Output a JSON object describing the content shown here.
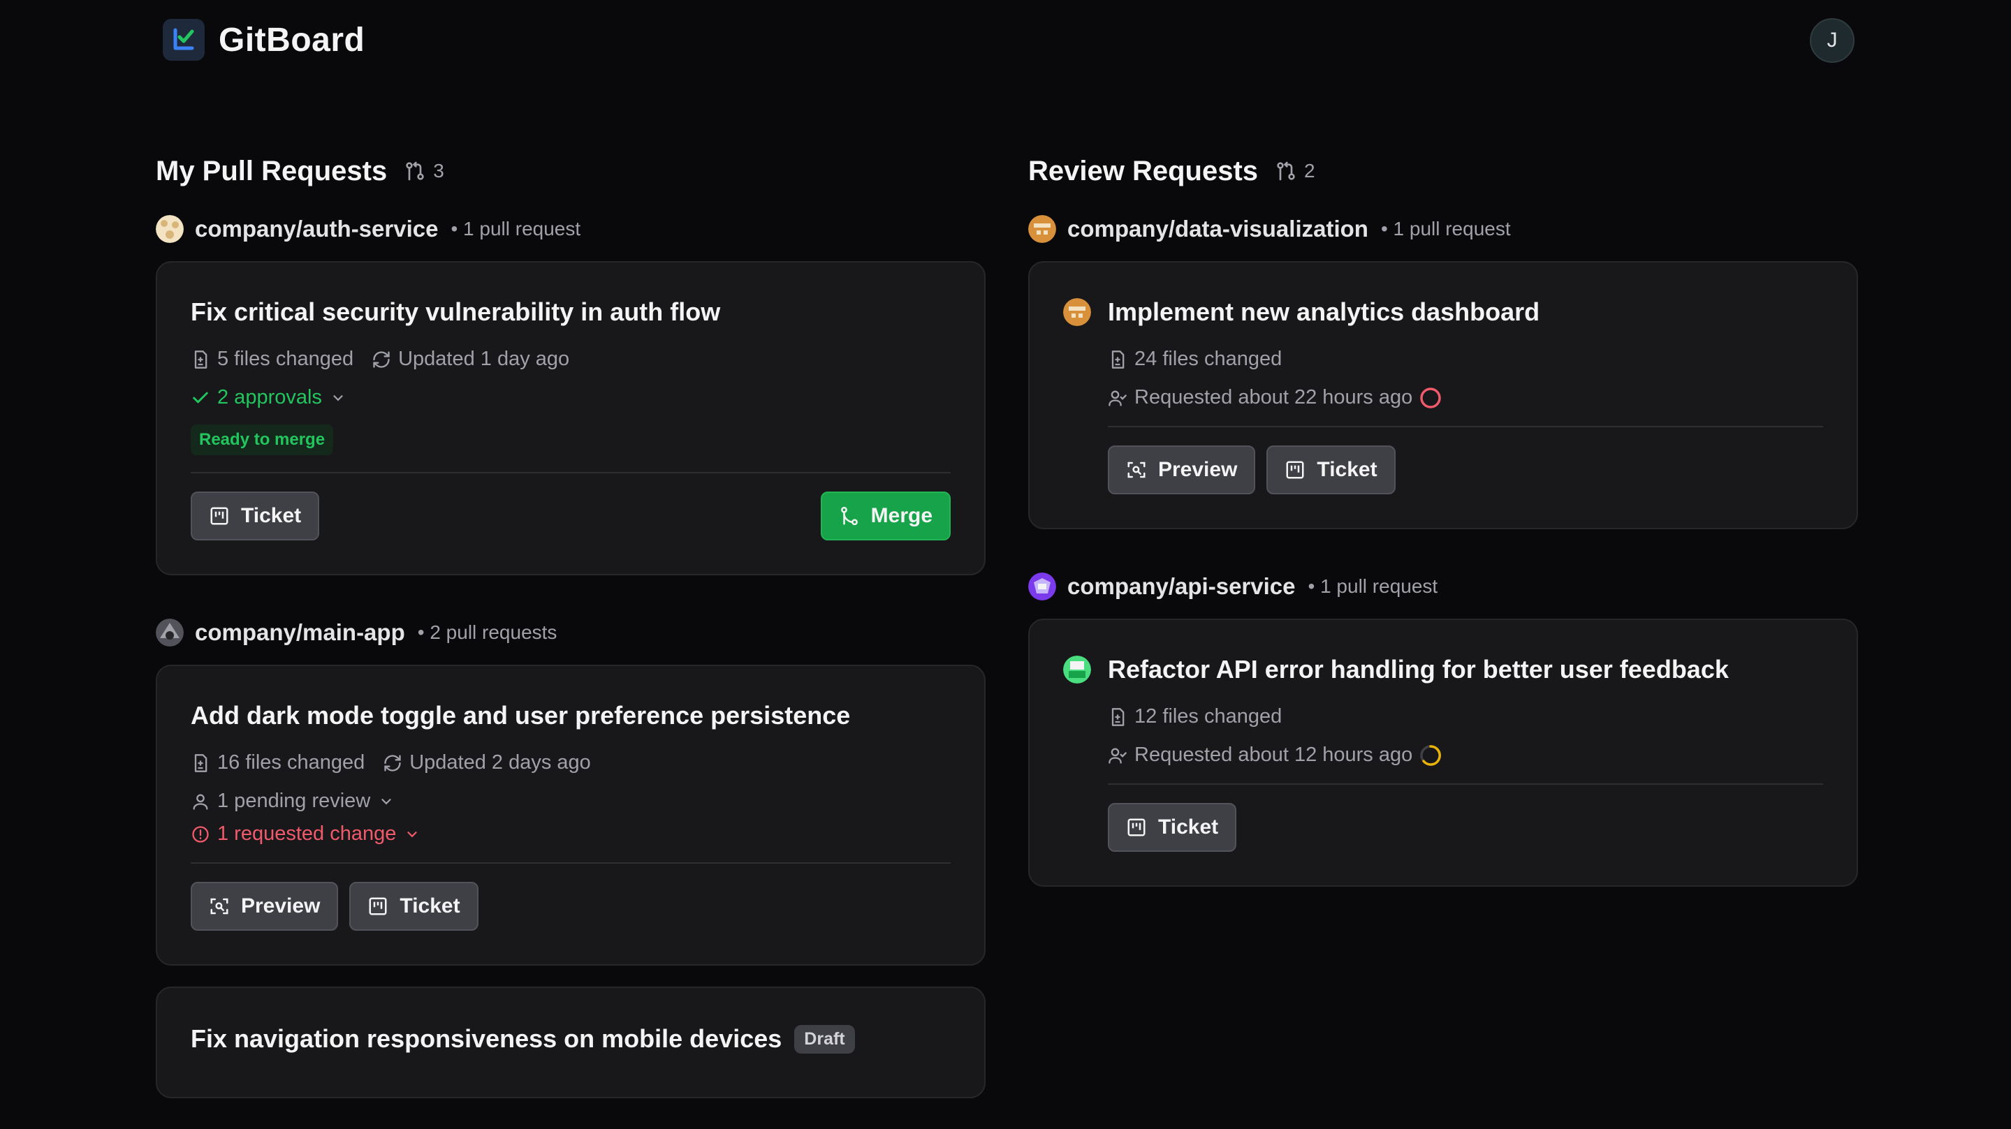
{
  "app": {
    "name": "GitBoard",
    "user_initial": "J"
  },
  "colors": {
    "background": "#09090b",
    "card": "#18181b",
    "success": "#22c55e",
    "danger": "#f05a6a",
    "warning": "#eab308",
    "merge": "#16a34a"
  },
  "my_prs": {
    "title": "My Pull Requests",
    "count": "3",
    "groups": [
      {
        "repo": "company/auth-service",
        "count": "• 1 pull request",
        "prs": [
          {
            "title": "Fix critical security vulnerability in auth flow",
            "files": "5 files changed",
            "updated": "Updated 1 day ago",
            "approvals": "2 approvals",
            "badge": "Ready to merge",
            "ticket": "Ticket",
            "merge": "Merge"
          }
        ]
      },
      {
        "repo": "company/main-app",
        "count": "• 2 pull requests",
        "prs": [
          {
            "title": "Add dark mode toggle and user preference persistence",
            "files": "16 files changed",
            "updated": "Updated 2 days ago",
            "pending": "1 pending review",
            "requested": "1 requested change",
            "preview": "Preview",
            "ticket": "Ticket"
          },
          {
            "title": "Fix navigation responsiveness on mobile devices",
            "draft": "Draft"
          }
        ]
      }
    ]
  },
  "review_requests": {
    "title": "Review Requests",
    "count": "2",
    "groups": [
      {
        "repo": "company/data-visualization",
        "count": "• 1 pull request",
        "prs": [
          {
            "title": "Implement new analytics dashboard",
            "files": "24 files changed",
            "requested": "Requested about 22 hours ago",
            "preview": "Preview",
            "ticket": "Ticket"
          }
        ]
      },
      {
        "repo": "company/api-service",
        "count": "• 1 pull request",
        "prs": [
          {
            "title": "Refactor API error handling for better user feedback",
            "files": "12 files changed",
            "requested": "Requested about 12 hours ago",
            "ticket": "Ticket"
          }
        ]
      }
    ]
  }
}
